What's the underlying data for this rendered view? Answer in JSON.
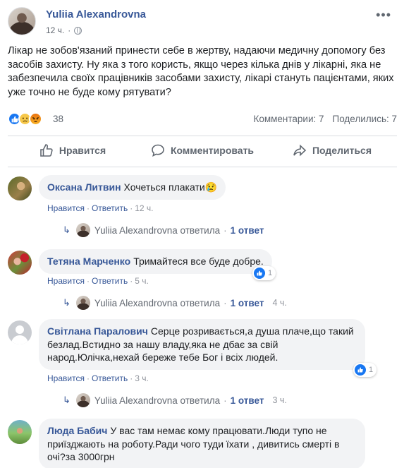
{
  "post": {
    "author": "Yuliia Alexandrovna",
    "time": "12 ч.",
    "more_label": "•••",
    "text": "Лікар не зобов'язаний принести себе в жертву, надаючи медичну допомогу без засобів захисту. Ну яка з того користь, якщо через кілька днів у лікарні, яка не забезпечила своїх працівників засобами захисту, лікарі стануть пацієнтами, яких уже точно не буде кому рятувати?",
    "reaction_count": "38",
    "reactions": [
      "like",
      "sad",
      "angry"
    ],
    "comments_count": "Комментарии: 7",
    "shares_count": "Поделились: 7"
  },
  "actions": {
    "like": "Нравится",
    "comment": "Комментировать",
    "share": "Поделиться"
  },
  "comments": [
    {
      "name": "Оксана Литвин",
      "text": "Хочеться плакати😢",
      "like_label": "Нравится",
      "reply_label": "Ответить",
      "time": "12 ч.",
      "reply": {
        "author": "Yuliia Alexandrovna",
        "action": "ответила",
        "count": "1 ответ",
        "time": ""
      }
    },
    {
      "name": "Тетяна Марченко",
      "text": "Тримайтеся все буде добре.",
      "like_label": "Нравится",
      "reply_label": "Ответить",
      "time": "5 ч.",
      "likes": "1",
      "reply": {
        "author": "Yuliia Alexandrovna",
        "action": "ответила",
        "count": "1 ответ",
        "time": "4 ч."
      }
    },
    {
      "name": "Світлана Паралович",
      "text": "Серце розривається,а душа плаче,що такий безлад.Встидно за нашу владу,яка не дбає за свій народ.Юлічка,нехай береже тебе Бог і всіх людей.",
      "like_label": "Нравится",
      "reply_label": "Ответить",
      "time": "3 ч.",
      "likes": "1",
      "reply": {
        "author": "Yuliia Alexandrovna",
        "action": "ответила",
        "count": "1 ответ",
        "time": "3 ч."
      }
    },
    {
      "name": "Люда Бабич",
      "text": "У вас там немає кому працювати.Люди тупо не приїзджають на роботу.Ради чого туди їхати , дивитись смерті в очі?за 3000грн"
    }
  ],
  "colors": {
    "link": "#385898",
    "secondary_text": "#606770",
    "bubble": "#f2f3f5",
    "like_blue": "#1877f2"
  }
}
